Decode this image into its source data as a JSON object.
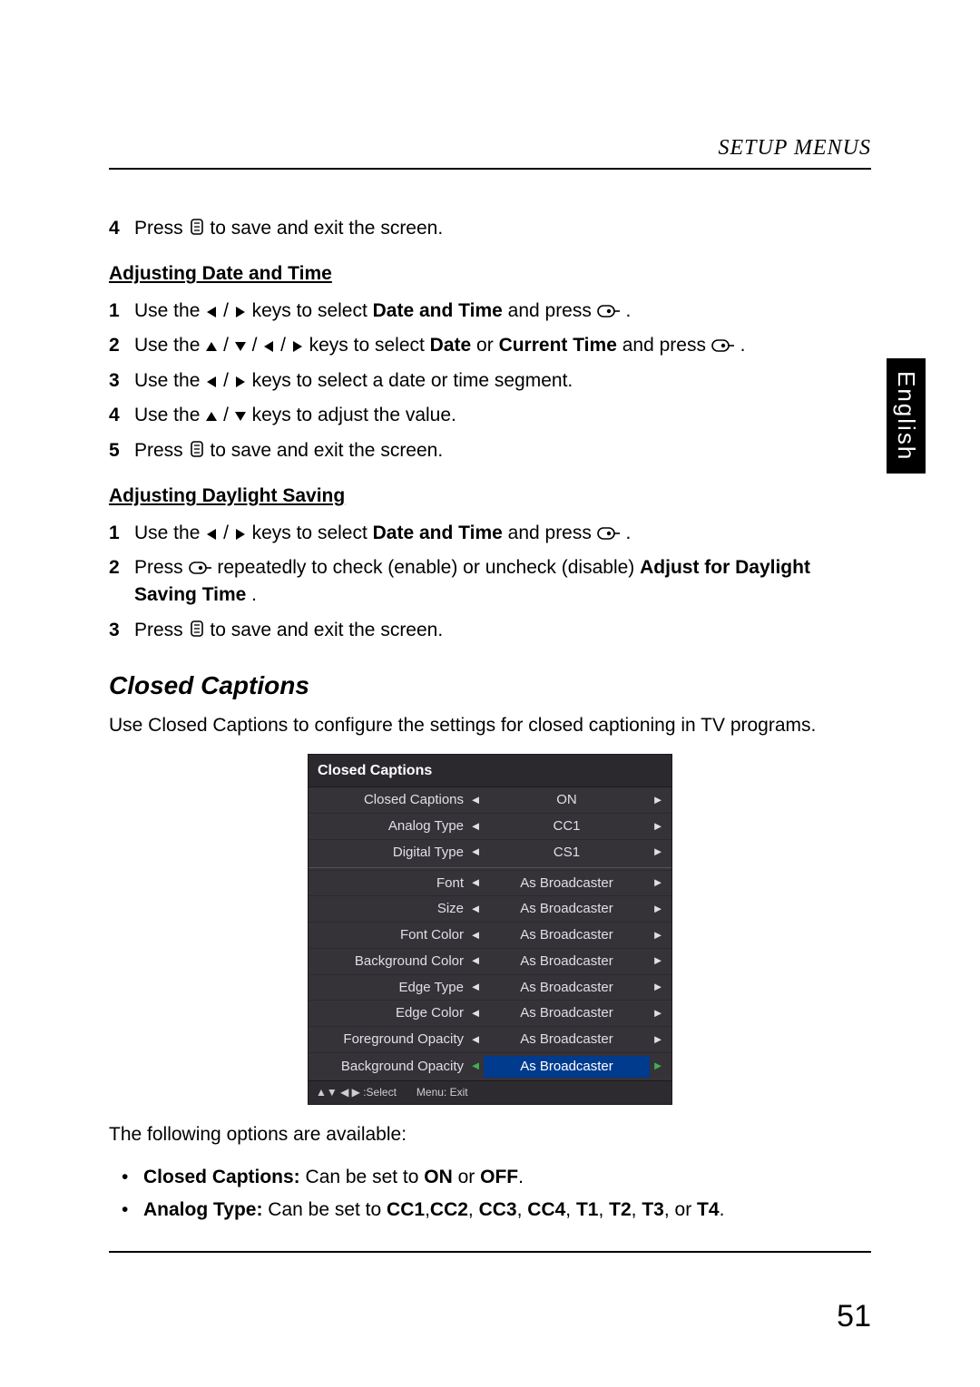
{
  "header": {
    "title": "SETUP MENUS"
  },
  "side_tab": "English",
  "page_number": "51",
  "tail_step": {
    "num": "4",
    "pre": "Press ",
    "post": " to save and exit the screen."
  },
  "date_time": {
    "heading": "Adjusting Date and Time",
    "steps": [
      {
        "num": "1",
        "pre": "Use the ",
        "mid": " keys to select ",
        "bold": "Date and Time",
        "post2": " and press ",
        "tail": "."
      },
      {
        "num": "2",
        "pre": "Use the ",
        "mid": " keys to select ",
        "bold": "Date",
        "or": " or ",
        "bold2": "Current Time",
        "post2": " and press ",
        "tail": "."
      },
      {
        "num": "3",
        "pre": "Use the ",
        "mid": " keys to select a date or time segment."
      },
      {
        "num": "4",
        "pre": "Use the ",
        "mid": " keys to adjust the value."
      },
      {
        "num": "5",
        "pre": "Press ",
        "post": " to save and exit the screen."
      }
    ]
  },
  "daylight": {
    "heading": "Adjusting Daylight Saving",
    "steps": [
      {
        "num": "1",
        "pre": "Use the ",
        "mid": " keys to select ",
        "bold": "Date and Time",
        "post2": " and press ",
        "tail": "."
      },
      {
        "num": "2",
        "pre": "Press ",
        "mid": " repeatedly to check (enable) or uncheck (disable) ",
        "bold": "Adjust for Daylight Saving Time",
        "tail": "."
      },
      {
        "num": "3",
        "pre": "Press ",
        "post": " to save and exit the screen."
      }
    ]
  },
  "closed_captions": {
    "title": "Closed Captions",
    "intro": "Use Closed Captions to configure the settings for closed captioning in TV programs.",
    "options_intro": "The following options are available:",
    "bullets": [
      {
        "bold": "Closed Captions:",
        "rest": " Can be set to ",
        "b2": "ON",
        "or": " or ",
        "b3": "OFF",
        "tail": "."
      },
      {
        "bold": "Analog Type:",
        "rest": " Can be set to ",
        "b2": "CC1",
        "c": ",",
        "b3": "CC2",
        "c2": ", ",
        "b4": "CC3",
        "c3": ", ",
        "b5": "CC4",
        "c4": ", ",
        "b6": "T1",
        "c5": ", ",
        "b7": "T2",
        "c6": ", ",
        "b8": "T3",
        "c7": ", or ",
        "b9": "T4",
        "tail": "."
      }
    ]
  },
  "osd": {
    "title": "Closed Captions",
    "groups": [
      [
        {
          "label": "Closed Captions",
          "value": "ON"
        },
        {
          "label": "Analog Type",
          "value": "CC1"
        },
        {
          "label": "Digital Type",
          "value": "CS1"
        }
      ],
      [
        {
          "label": "Font",
          "value": "As Broadcaster"
        },
        {
          "label": "Size",
          "value": "As Broadcaster"
        },
        {
          "label": "Font Color",
          "value": "As Broadcaster"
        },
        {
          "label": "Background Color",
          "value": "As Broadcaster"
        },
        {
          "label": "Edge Type",
          "value": "As Broadcaster"
        },
        {
          "label": "Edge Color",
          "value": "As Broadcaster"
        },
        {
          "label": "Foreground Opacity",
          "value": "As Broadcaster"
        },
        {
          "label": "Background Opacity",
          "value": "As Broadcaster",
          "selected": true
        }
      ]
    ],
    "footer": {
      "select": ":Select",
      "exit": "Menu: Exit"
    }
  }
}
